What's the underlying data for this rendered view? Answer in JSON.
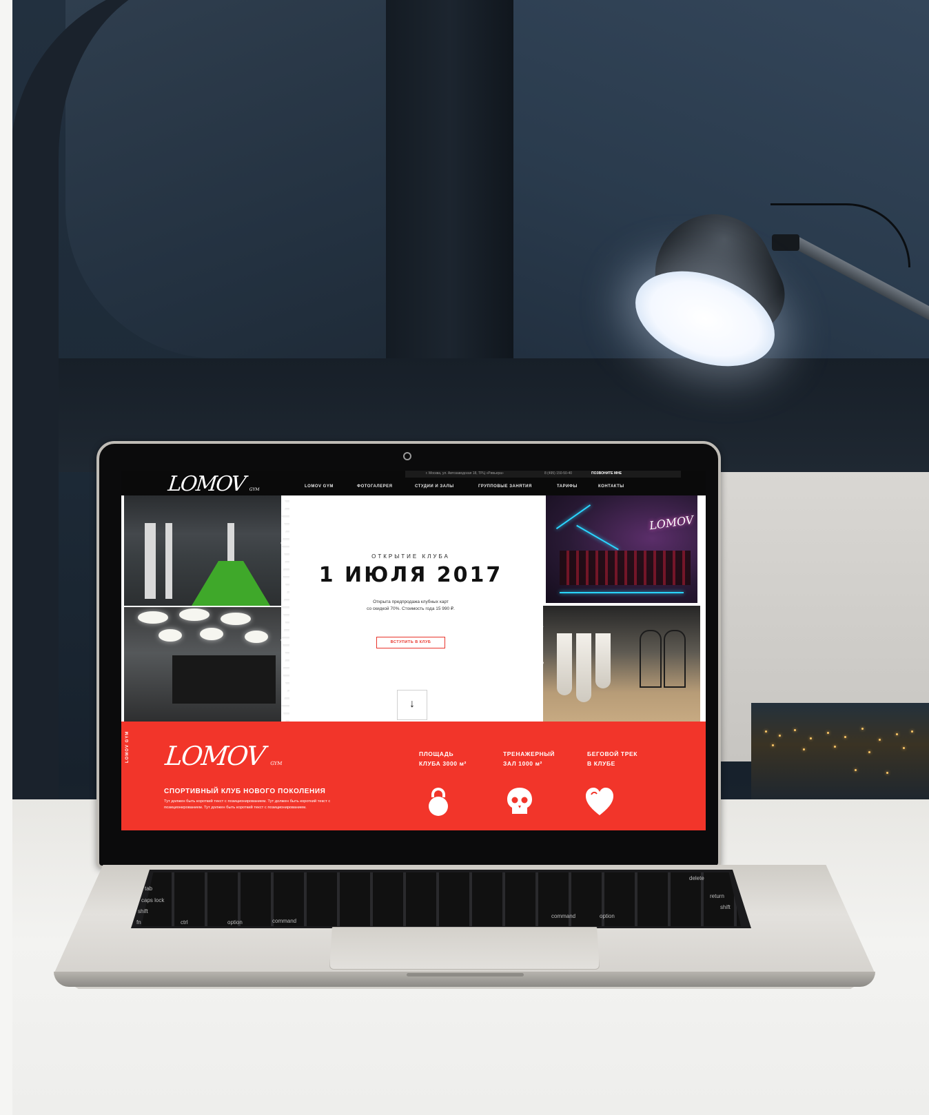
{
  "site": {
    "logo": "LOMOV",
    "logo_sub": "GYM",
    "topbar": {
      "address": "г. Москва, ул. Автозаводская 18, ТРЦ «Ривьера»",
      "phone": "8 (495) 150-50-40",
      "callback": "ПОЗВОНИТЕ МНЕ"
    },
    "nav": [
      "LOMOV GYM",
      "ФОТОГАЛЕРЕЯ",
      "СТУДИИ И ЗАЛЫ",
      "ГРУППОВЫЕ ЗАНЯТИЯ",
      "ТАРИФЫ",
      "КОНТАКТЫ"
    ],
    "hero": {
      "kicker": "ОТКРЫТИЕ КЛУБА",
      "headline": "1 ИЮЛЯ 2017",
      "subtext_line1": "Открыта предпродажа клубных карт",
      "subtext_line2": "со скидкой 70%. Стоимость года 15 990 ₽.",
      "cta": "ВСТУПИТЬ В КЛУБ",
      "scroll_arrow": "↓",
      "photo_logo": "LOMOV"
    },
    "about": {
      "vertical_label": "LOMOV GYM",
      "logo": "LOMOV",
      "logo_sub": "GYM",
      "title": "СПОРТИВНЫЙ КЛУБ НОВОГО ПОКОЛЕНИЯ",
      "body": "Тут должен быть короткий текст с позиционированием. Тут должен быть короткий текст с позиционированием. Тут должен быть короткий текст с позиционированием.",
      "stats": [
        {
          "line1": "ПЛОЩАДЬ",
          "line2": "КЛУБА 3000 м²",
          "icon": "kettlebell-icon"
        },
        {
          "line1": "ТРЕНАЖЕРНЫЙ",
          "line2": "ЗАЛ 1000 м²",
          "icon": "skull-icon"
        },
        {
          "line1": "БЕГОВОЙ ТРЕК",
          "line2": "В КЛУБЕ",
          "icon": "heart-icon"
        }
      ]
    }
  },
  "keyboard": {
    "keys": [
      "tab",
      "caps lock",
      "shift",
      "fn",
      "ctrl",
      "option",
      "command",
      "command",
      "option",
      "delete",
      "return",
      "shift"
    ]
  },
  "colors": {
    "accent_red": "#f2352a",
    "turf_green": "#3fa82a",
    "neon_cyan": "#2ad6ff"
  }
}
